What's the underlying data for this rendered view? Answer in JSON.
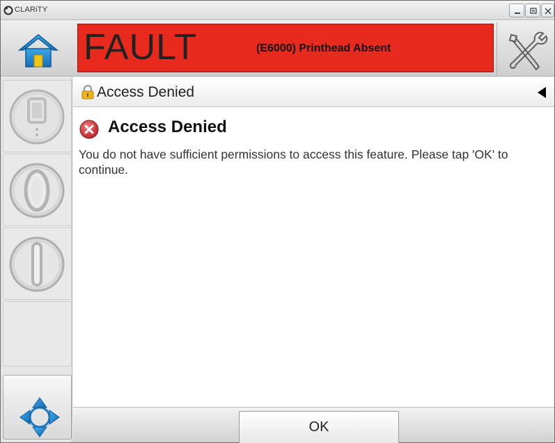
{
  "window": {
    "title": "CLARiTY",
    "controls": {
      "minimize_icon": "minimize-icon",
      "maximize_icon": "maximize-icon",
      "close_icon": "close-icon"
    }
  },
  "header": {
    "home_icon": "home-icon",
    "status_word": "FAULT",
    "fault_message": "(E6000) Printhead Absent",
    "status_color": "#e8291d",
    "tools_icon": "tools-icon"
  },
  "sidebar": {
    "buttons": [
      {
        "icon": "ink-system-icon"
      },
      {
        "icon": "printer-stop-icon"
      },
      {
        "icon": "printer-start-icon"
      }
    ],
    "nav_icon": "navigation-arrows-icon"
  },
  "page": {
    "breadcrumb": "Access Denied",
    "lock_icon": "lock-icon",
    "back_icon": "back-arrow-icon"
  },
  "dialog": {
    "title": "Access Denied",
    "icon": "error-icon",
    "message": "You do not have sufficient permissions to access this feature.  Please tap 'OK' to continue."
  },
  "footer": {
    "ok_label": "OK"
  },
  "colors": {
    "accent_blue": "#1e8fd6",
    "fault_red": "#e8291d",
    "error_red": "#c8282d"
  }
}
